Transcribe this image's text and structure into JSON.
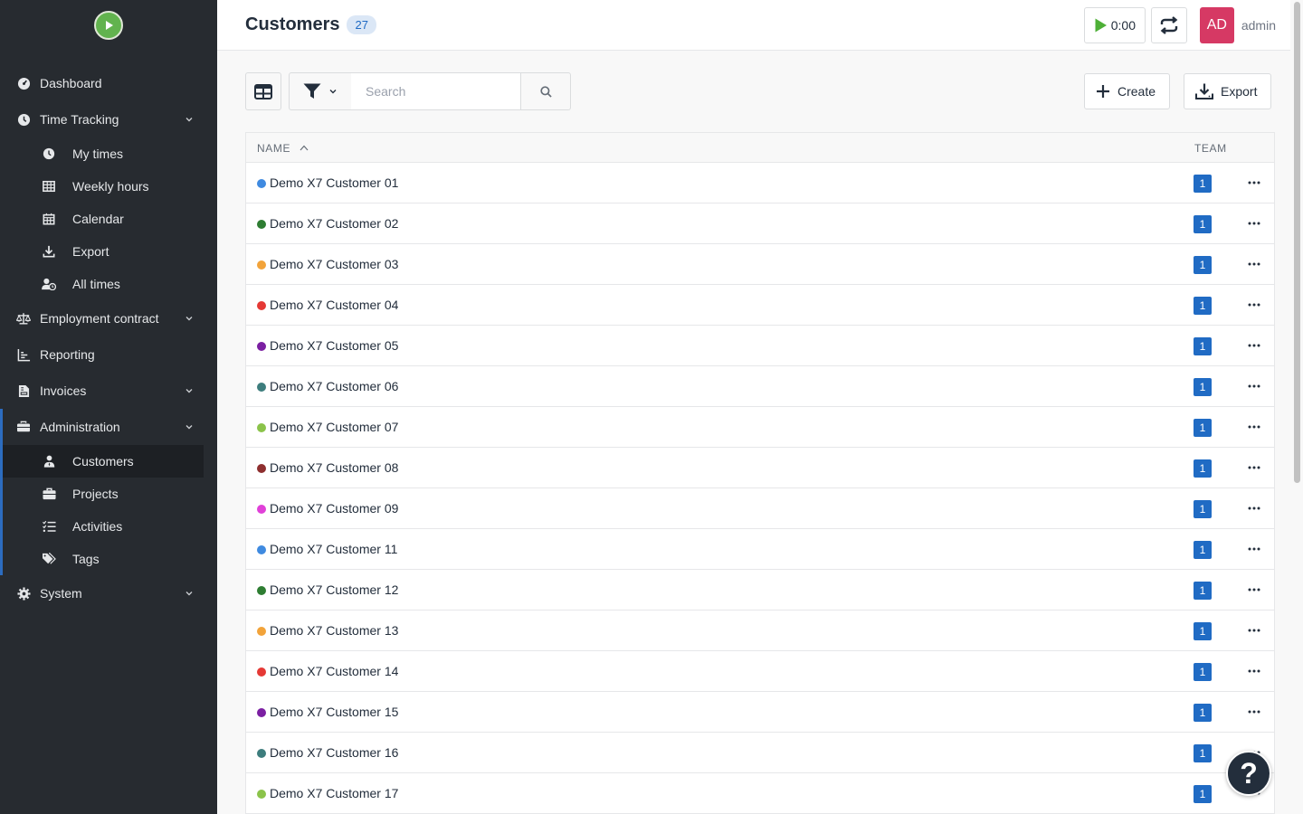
{
  "app": {
    "logo_icon": "play-logo-icon",
    "accent": "#206bc4",
    "sidebar_bg": "#272b30"
  },
  "sidebar": {
    "dashboard": "Dashboard",
    "time_tracking": "Time Tracking",
    "my_times": "My times",
    "weekly_hours": "Weekly hours",
    "calendar": "Calendar",
    "export": "Export",
    "all_times": "All times",
    "employment_contract": "Employment contract",
    "reporting": "Reporting",
    "invoices": "Invoices",
    "administration": "Administration",
    "customers": "Customers",
    "projects": "Projects",
    "activities": "Activities",
    "tags": "Tags",
    "system": "System"
  },
  "header": {
    "title": "Customers",
    "count": "27",
    "timer": "0:00",
    "avatar_initials": "AD",
    "avatar_color": "#d63964",
    "username": "admin"
  },
  "toolbar": {
    "search_placeholder": "Search",
    "create_label": "Create",
    "export_label": "Export"
  },
  "table": {
    "columns": {
      "name": "NAME",
      "team": "TEAM"
    },
    "rows": [
      {
        "name": "Demo X7 Customer 01",
        "color": "#3f8ae0",
        "team": "1"
      },
      {
        "name": "Demo X7 Customer 02",
        "color": "#2e7d32",
        "team": "1"
      },
      {
        "name": "Demo X7 Customer 03",
        "color": "#f2a33a",
        "team": "1"
      },
      {
        "name": "Demo X7 Customer 04",
        "color": "#e53935",
        "team": "1"
      },
      {
        "name": "Demo X7 Customer 05",
        "color": "#7b1fa2",
        "team": "1"
      },
      {
        "name": "Demo X7 Customer 06",
        "color": "#3d7d7d",
        "team": "1"
      },
      {
        "name": "Demo X7 Customer 07",
        "color": "#8bc34a",
        "team": "1"
      },
      {
        "name": "Demo X7 Customer 08",
        "color": "#8e2f2f",
        "team": "1"
      },
      {
        "name": "Demo X7 Customer 09",
        "color": "#e040d8",
        "team": "1"
      },
      {
        "name": "Demo X7 Customer 11",
        "color": "#3f8ae0",
        "team": "1"
      },
      {
        "name": "Demo X7 Customer 12",
        "color": "#2e7d32",
        "team": "1"
      },
      {
        "name": "Demo X7 Customer 13",
        "color": "#f2a33a",
        "team": "1"
      },
      {
        "name": "Demo X7 Customer 14",
        "color": "#e53935",
        "team": "1"
      },
      {
        "name": "Demo X7 Customer 15",
        "color": "#7b1fa2",
        "team": "1"
      },
      {
        "name": "Demo X7 Customer 16",
        "color": "#3d7d7d",
        "team": "1"
      },
      {
        "name": "Demo X7 Customer 17",
        "color": "#8bc34a",
        "team": "1"
      }
    ]
  },
  "help": {
    "label": "?"
  }
}
